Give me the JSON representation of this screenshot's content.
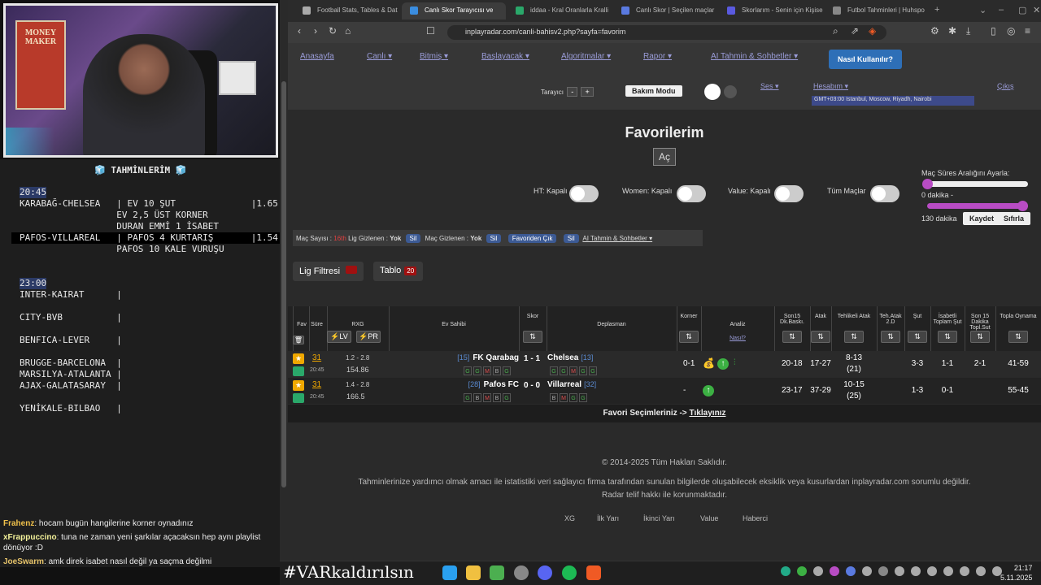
{
  "stream": {
    "poster_text": "MONEY MAKER",
    "notes_title": "🧊 TAHMİNLERİM 🧊",
    "notes": [
      {
        "text": "20:45",
        "time": true
      },
      {
        "text": "KARABAĞ-CHELSEA   | EV 10 ŞUT              |1.65"
      },
      {
        "text": "                  EV 2,5 ÜST KORNER"
      },
      {
        "text": "                  DURAN EMMİ 1 İSABET"
      },
      {
        "text": "PAFOS-VILLAREAL   | PAFOS 4 KURTARIŞ       |1.54",
        "highlight": true
      },
      {
        "text": "                  PAFOS 10 KALE VURUŞU"
      },
      {
        "text": ""
      },
      {
        "text": ""
      },
      {
        "text": "23:00",
        "time": true
      },
      {
        "text": "INTER-KAIRAT      |"
      },
      {
        "text": ""
      },
      {
        "text": "CITY-BVB          |"
      },
      {
        "text": ""
      },
      {
        "text": "BENFICA-LEVER     |"
      },
      {
        "text": ""
      },
      {
        "text": "BRUGGE-BARCELONA  |"
      },
      {
        "text": "MARSILYA-ATALANTA |"
      },
      {
        "text": "AJAX-GALATASARAY  |"
      },
      {
        "text": ""
      },
      {
        "text": "YENİKALE-BILBAO   |"
      }
    ],
    "chat": [
      {
        "user": "Frahenz",
        "color": "#f0c14b",
        "msg": ": hocam bugün hangilerine korner oynadınız"
      },
      {
        "user": "xFrappuccino",
        "color": "#f4f29a",
        "msg": ": tuna ne zaman yeni şarkılar açacaksın hep aynı playlist dönüyor :D"
      },
      {
        "user": "JoeSwarm",
        "color": "#e6c36a",
        "msg": ": amk direk isabet nasıl değil ya saçma değilmi"
      }
    ],
    "overlay": "#VARkaldırılsın"
  },
  "browser": {
    "tabs": [
      "Football Stats, Tables & Dat",
      "Canlı Skor Tarayıcısı ve",
      "iddaa - Kral Oranlarla Kralli",
      "Canlı Skor | Seçilen maçlar",
      "Skorlarım - Senin için Kişise",
      "Futbol Tahminleri | Huhspo"
    ],
    "url": "inplayradar.com/canli-bahisv2.php?sayfa=favorim",
    "clock_time": "21:17",
    "clock_date": "5.11.2025"
  },
  "nav": {
    "items": [
      "Anasayfa",
      "Canlı ▾",
      "Bitmiş ▾",
      "Başlayacak ▾",
      "Algoritmalar ▾",
      "Rapor ▾",
      "AI Tahmin & Sohbetler ▾"
    ],
    "how": "Nasıl Kullanılır?",
    "scanner": "Tarayıcı",
    "minus": "-",
    "plus": "+",
    "maintenance": "Bakım Modu",
    "sound": "Ses ▾",
    "account": "Hesabım ▾",
    "logout": "Çıkış",
    "timezone": "GMT+03:00 Istanbul, Moscow, Riyadh, Nairobi"
  },
  "main": {
    "title": "Favorilerim",
    "open": "Aç",
    "toggles": [
      "HT: Kapalı",
      "Women: Kapalı",
      "Value: Kapalı",
      "Tüm Maçlar"
    ],
    "range_title": "Maç Süres Aralığını Ayarla:",
    "range_min": "0 dakika -",
    "range_max": "130 dakika",
    "save": "Kaydet",
    "reset": "Sıfırla",
    "bar": {
      "count_label": "Maç Sayısı :",
      "count": "16th",
      "lig_hidden": "Lig Gizlenen :",
      "yok": "Yok",
      "sil": "Sil",
      "mac_hidden": "Maç Gizlenen :",
      "fav_out": "Favoriden Çık",
      "ai": "AI Tahmin & Sohbetler ▾"
    },
    "lig_filter": "Lig Filtresi",
    "table_btn": "Tablo",
    "table_count": "20"
  },
  "table": {
    "headers": {
      "fav": "Fav",
      "sure": "Süre",
      "rxg": "RXG",
      "lv": "LV",
      "pr": "PR",
      "home": "Ev Sahibi",
      "score": "Skor",
      "away": "Deplasman",
      "corner": "Korner",
      "analysis": "Analiz",
      "how": "Nasıl?",
      "son15": "Son15 Dk.Baskı.",
      "atak": "Atak",
      "tehatak": "Tehlikeli Atak",
      "teh2": "Teh.Atak 2.D",
      "sut": "Şut",
      "isabet": "İsabetli Toplam Şut",
      "son15sut": "Son 15 Dakika Topl.Sut",
      "topla": "Topla Oynama"
    },
    "rows": [
      {
        "min": "31",
        "time": "20:45",
        "rxg": "1.2 - 2.8",
        "rxg2": "154.86",
        "home_rank": "[15]",
        "home": "FK Qarabag",
        "score": "1 - 1",
        "away": "Chelsea",
        "away_rank": "[13]",
        "home_form": [
          "G",
          "G",
          "M",
          "B",
          "G"
        ],
        "away_form": [
          "G",
          "G",
          "M",
          "G",
          "G"
        ],
        "corner": "0-1",
        "son15": "20-18",
        "atak": "17-27",
        "tehatak": "8-13",
        "tehatak2": "(21)",
        "sut": "3-3",
        "isabet": "1-1",
        "son15sut": "2-1",
        "topla": "41-59"
      },
      {
        "min": "31",
        "time": "20:45",
        "rxg": "1.4 - 2.8",
        "rxg2": "166.5",
        "home_rank": "[28]",
        "home": "Pafos FC",
        "score": "0 - 0",
        "away": "Villarreal",
        "away_rank": "[32]",
        "home_form": [
          "G",
          "B",
          "M",
          "B",
          "G"
        ],
        "away_form": [
          "B",
          "M",
          "G",
          "G"
        ],
        "corner": "-",
        "son15": "23-17",
        "atak": "37-29",
        "tehatak": "10-15",
        "tehatak2": "(25)",
        "sut": "1-3",
        "isabet": "0-1",
        "son15sut": "",
        "topla": "55-45"
      }
    ],
    "footer_text": "Favori Seçimleriniz ->",
    "footer_link": "Tıklayınız"
  },
  "footer": {
    "copy": "© 2014-2025 Tüm Hakları Saklıdır.",
    "disclaimer1": "Tahminlerinize yardımcı olmak amacı ile istatistiki veri sağlayıcı firma tarafından sunulan bilgilerde oluşabilecek eksiklik veya kusurlardan inplayradar.com sorumlu değildir.",
    "disclaimer2": "Radar telif hakkı ile korunmaktadır.",
    "links": [
      "XG",
      "İlk Yarı",
      "İkinci Yarı",
      "Value",
      "Haberci"
    ]
  },
  "colors": {
    "accent": "#2e6fb7",
    "purple": "#b84cc4",
    "green": "#3cb043"
  }
}
